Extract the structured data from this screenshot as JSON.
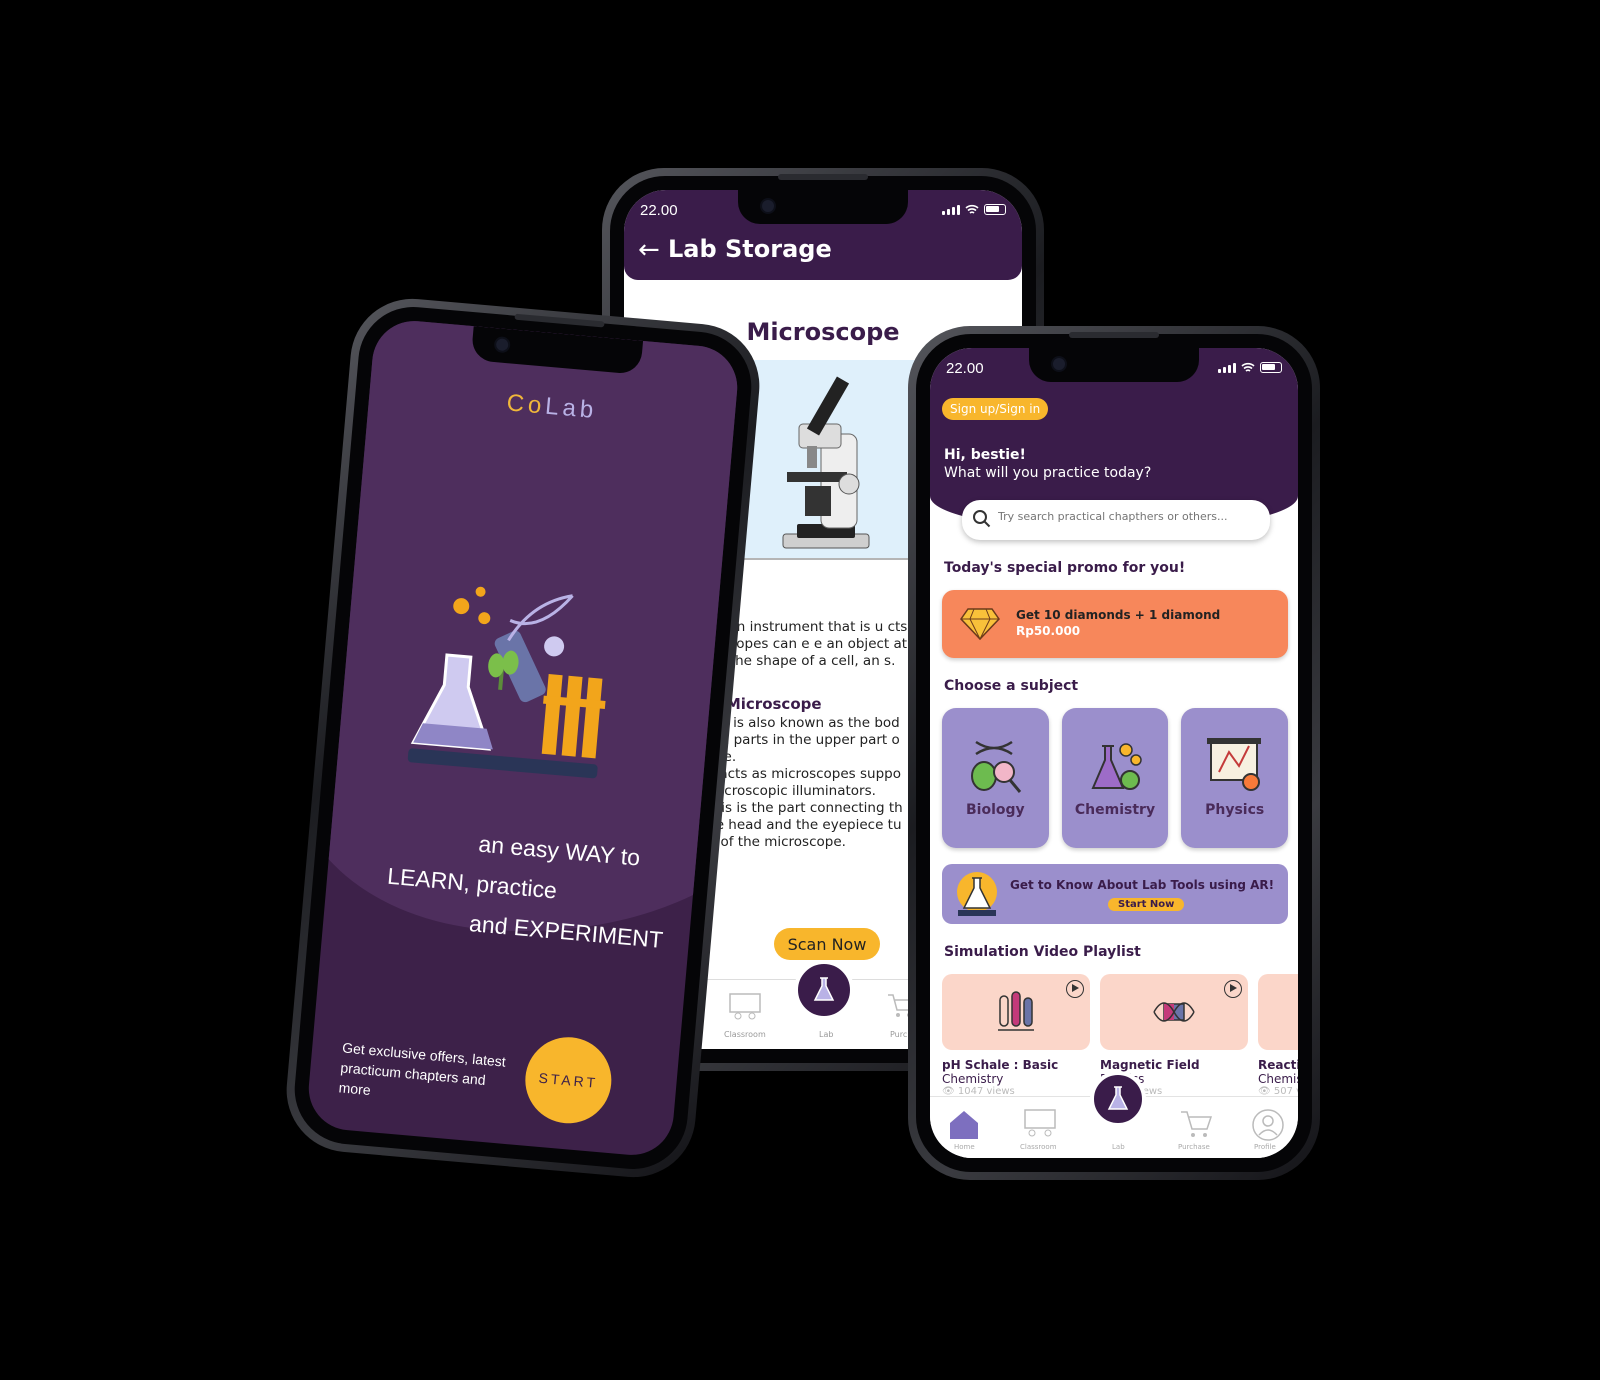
{
  "colors": {
    "purple_dark": "#3a1c4a",
    "purple_mid": "#4e2e5d",
    "lavender": "#9b8fcc",
    "accent_yellow": "#f8b62c",
    "promo_orange": "#f7875b",
    "peach": "#fbd6c9"
  },
  "splash": {
    "logo_co": "Co",
    "logo_lab": "Lab",
    "slogan": [
      "an easy WAY to",
      "LEARN, practice",
      "and EXPERIMENT"
    ],
    "offer": "Get exclusive offers, latest practicum chapters and more",
    "start_label": "START"
  },
  "lab_storage": {
    "time": "22.00",
    "title": "Lab Storage",
    "tool_title": "Microscope",
    "section1_head": "n",
    "section1_text": "ope is an instrument that is u cts. Some microscopes can e e an object at the cellular leve to see the shape of a cell, an s.",
    "section2_head": "rt of Microscope",
    "section2_lines": [
      "l - This is also known as the bod",
      "optical parts in the upper part o",
      "oscope.",
      "e - It acts as microscopes suppo",
      "ies microscopic illuminators.",
      "s - This is the part connecting th",
      "to the head and the eyepiece tu",
      "base of the microscope."
    ],
    "scan_label": "Scan Now",
    "nav": {
      "classroom": "Classroom",
      "lab": "Lab",
      "purchase": "Purc"
    }
  },
  "home": {
    "time": "22.00",
    "signup_label": "Sign up/Sign in",
    "greeting_line1": "Hi, bestie!",
    "greeting_line2": "What will you practice today?",
    "search_placeholder": "Try search practical chapthers or others...",
    "promo_title": "Today's special promo for you!",
    "promo_line1": "Get 10 diamonds + 1 diamond",
    "promo_line2": "Rp50.000",
    "subject_title": "Choose a subject",
    "subjects": [
      {
        "label": "Biology"
      },
      {
        "label": "Chemistry"
      },
      {
        "label": "Physics"
      }
    ],
    "ar_text": "Get to Know About Lab Tools using AR!",
    "ar_button": "Start Now",
    "playlist_title": "Simulation Video Playlist",
    "videos": [
      {
        "title": "pH Schale : Basic",
        "subject": "Chemistry",
        "views": "1047 views"
      },
      {
        "title": "Magnetic Field",
        "subject": "Physics",
        "views": "views"
      },
      {
        "title": "Reacti",
        "subject": "Chemis",
        "views": "507 v"
      }
    ],
    "nav": {
      "home": "Home",
      "classroom": "Classroom",
      "lab": "Lab",
      "purchase": "Purchase",
      "profile": "Profile"
    }
  }
}
